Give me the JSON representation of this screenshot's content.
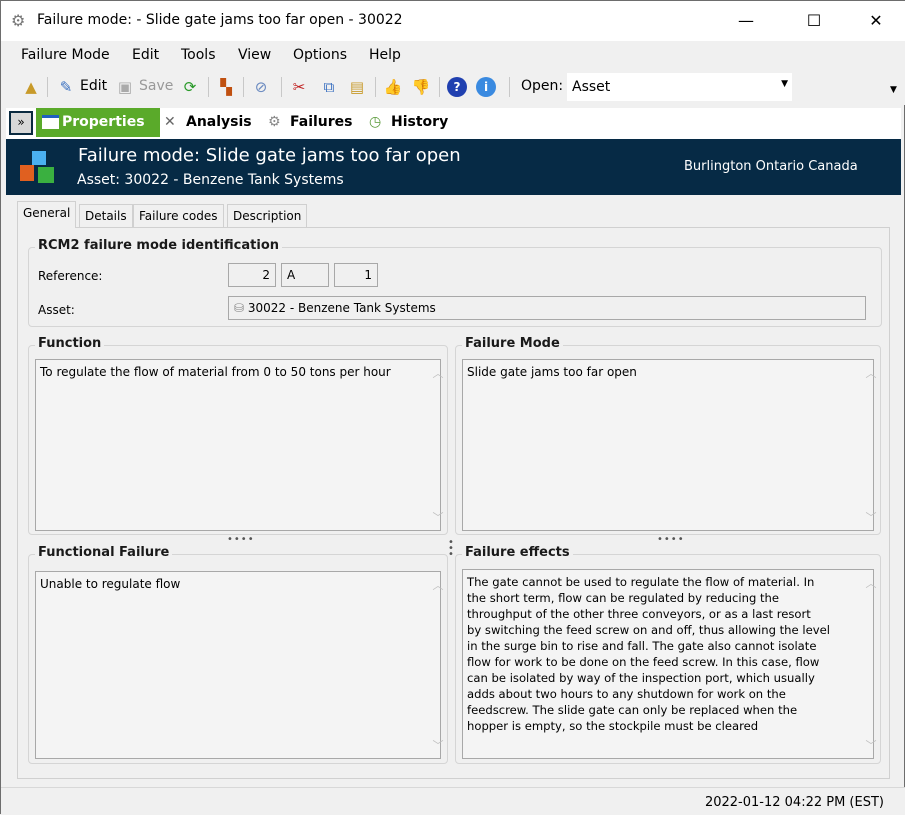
{
  "window": {
    "title": "Failure mode:  - Slide gate jams too far open - 30022",
    "minimize": "—",
    "maximize": "☐",
    "close": "✕"
  },
  "menu": [
    "Failure Mode",
    "Edit",
    "Tools",
    "View",
    "Options",
    "Help"
  ],
  "toolbar": {
    "edit": "Edit",
    "save": "Save",
    "open_label": "Open:",
    "open_value": "Asset"
  },
  "nav": {
    "properties": "Properties",
    "analysis": "Analysis",
    "failures": "Failures",
    "history": "History"
  },
  "header": {
    "title": "Failure mode:  Slide gate jams too far open",
    "subtitle": "Asset: 30022 - Benzene Tank Systems",
    "location": "Burlington Ontario Canada"
  },
  "tabs": [
    "General",
    "Details",
    "Failure codes",
    "Description"
  ],
  "identification": {
    "legend": "RCM2 failure mode identification",
    "reference_label": "Reference:",
    "ref1": "2",
    "ref2": "A",
    "ref3": "1",
    "asset_label": "Asset:",
    "asset_value": "30022 - Benzene Tank Systems"
  },
  "function": {
    "legend": "Function",
    "text": "To regulate the flow of material from 0 to 50 tons per hour"
  },
  "failure_mode": {
    "legend": "Failure Mode",
    "text": "Slide gate jams too far open"
  },
  "functional_failure": {
    "legend": "Functional Failure",
    "text": "Unable to regulate flow"
  },
  "failure_effects": {
    "legend": "Failure effects",
    "lines": [
      "The gate cannot be used to regulate the flow of material. In",
      "the short term, flow can be regulated by reducing the",
      "throughput of the other three conveyors, or as a last resort",
      "by switching the feed screw on and off, thus allowing the level",
      "in the surge bin to rise and fall. The gate also cannot isolate",
      "flow for work to be done on the feed screw. In this case, flow",
      "can be isolated by way of the inspection port, which usually",
      "adds about two hours to any shutdown for work on the",
      "feedscrew. The slide gate can only be replaced when the",
      "hopper is empty, so the stockpile must be cleared"
    ]
  },
  "status": {
    "timestamp": "2022-01-12 04:22 PM (EST)"
  }
}
